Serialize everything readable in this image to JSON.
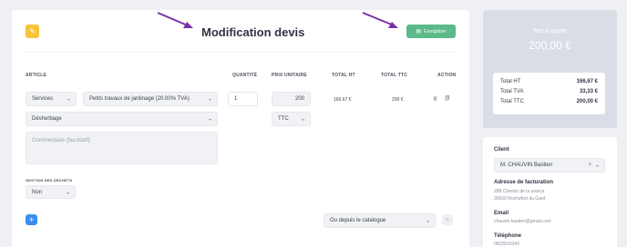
{
  "header": {
    "back_icon": "pencil-icon",
    "title": "Modification devis",
    "save_label": "Enregistrer",
    "save_icon": "save-icon"
  },
  "columns": {
    "article": "ARTICLE",
    "quantite": "QUANTITÉ",
    "prix_unitaire": "PRIX UNITAIRE",
    "total_ht": "TOTAL HT",
    "total_ttc": "TOTAL TTC",
    "action": "ACTION"
  },
  "line": {
    "category": "Services",
    "product": "Petits travaux de jardinage (20.00% TVA)",
    "quantity": "1",
    "unit_price": "200",
    "total_ht": "166.67 €",
    "total_ttc": "200 €",
    "subcategory": "Désherbage",
    "price_mode": "TTC",
    "comment_placeholder": "Commentaire (facultatif)"
  },
  "gestion": {
    "label": "GESTION DES DÉCHETS",
    "value": "Non"
  },
  "catalogue": {
    "label": "Ou depuis le catalogue"
  },
  "payment": {
    "title": "Net à payer",
    "amount": "200,00 €",
    "totals": [
      {
        "label": "Total HT",
        "value": "166,67 €"
      },
      {
        "label": "Total TVA",
        "value": "33,33 €"
      },
      {
        "label": "Total TTC",
        "value": "200,00 €"
      }
    ]
  },
  "client": {
    "label": "Client",
    "selected": "M. CHAUVIN Bastien",
    "billing_label": "Adresse de facturation",
    "billing_line1": "288 Chemin de la source",
    "billing_line2": "30650 Rochefort du Gard",
    "email_label": "Email",
    "email": "chauvin.bastien@gmail.com",
    "phone_label": "Téléphone",
    "phone": "0622819349"
  },
  "colors": {
    "accent_yellow": "#f6c33a",
    "accent_green": "#5cb98a",
    "accent_blue": "#3b8ef0",
    "arrow_purple": "#7b2fa8"
  }
}
